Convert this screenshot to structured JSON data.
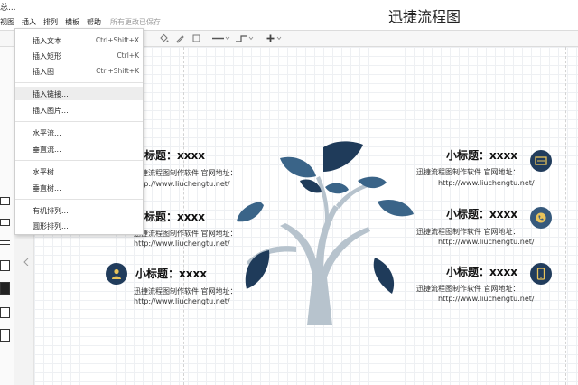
{
  "window": {
    "title_fragment": "总..."
  },
  "menubar": {
    "items": [
      {
        "label": "视图"
      },
      {
        "label": "插入"
      },
      {
        "label": "排列"
      },
      {
        "label": "横板"
      },
      {
        "label": "帮助"
      }
    ],
    "save_status": "所有更改已保存"
  },
  "app_title": "迅捷流程图",
  "toolbar": {
    "icons": [
      "paint-bucket-icon",
      "pen-icon",
      "square-icon",
      "line-style-icon",
      "connector-icon",
      "add-icon"
    ]
  },
  "insert_menu": {
    "items": [
      {
        "label": "插入文本",
        "shortcut": "Ctrl+Shift+X"
      },
      {
        "label": "插入矩形",
        "shortcut": "Ctrl+K"
      },
      {
        "label": "插入图",
        "shortcut": "Ctrl+Shift+K"
      },
      {
        "label": "插入链接...",
        "shortcut": ""
      },
      {
        "label": "插入图片...",
        "shortcut": ""
      },
      {
        "label": "水平流...",
        "shortcut": ""
      },
      {
        "label": "垂直流...",
        "shortcut": ""
      },
      {
        "label": "水平树...",
        "shortcut": ""
      },
      {
        "label": "垂直树...",
        "shortcut": ""
      },
      {
        "label": "有机排列...",
        "shortcut": ""
      },
      {
        "label": "圆形排列...",
        "shortcut": ""
      }
    ]
  },
  "diagram": {
    "cards": [
      {
        "title": "小标题：xxxx",
        "line1": "迅捷流程图制作软件 官网地址：",
        "url": "http://www.liuchengtu.net/"
      },
      {
        "title": "小标题：xxxx",
        "line1": "迅捷流程图制作软件 官网地址：",
        "url": "http://www.liuchengtu.net/"
      },
      {
        "title": "小标题：xxxx",
        "line1": "迅捷流程图制作软件 官网地址：",
        "url": "http://www.liuchengtu.net/"
      },
      {
        "title": "小标题：xxxx",
        "line1": "迅捷流程图制作软件 官网地址：",
        "url": "http://www.liuchengtu.net/"
      },
      {
        "title": "小标题：xxxx",
        "line1": "迅捷流程图制作软件 官网地址：",
        "url": "http://www.liuchengtu.net/"
      },
      {
        "title": "小标题：xxxx",
        "line1": "迅捷流程图制作软件 官网地址：",
        "url": "http://www.liuchengtu.net/"
      }
    ],
    "icons": [
      "user-icon",
      "display-icon",
      "phone-icon",
      "mobile-icon"
    ],
    "colors": {
      "icon_circle": "#213c5c",
      "leaf_dark": "#1f3b5a",
      "leaf_mid": "#3a6488",
      "trunk": "#b7c3cd"
    }
  }
}
